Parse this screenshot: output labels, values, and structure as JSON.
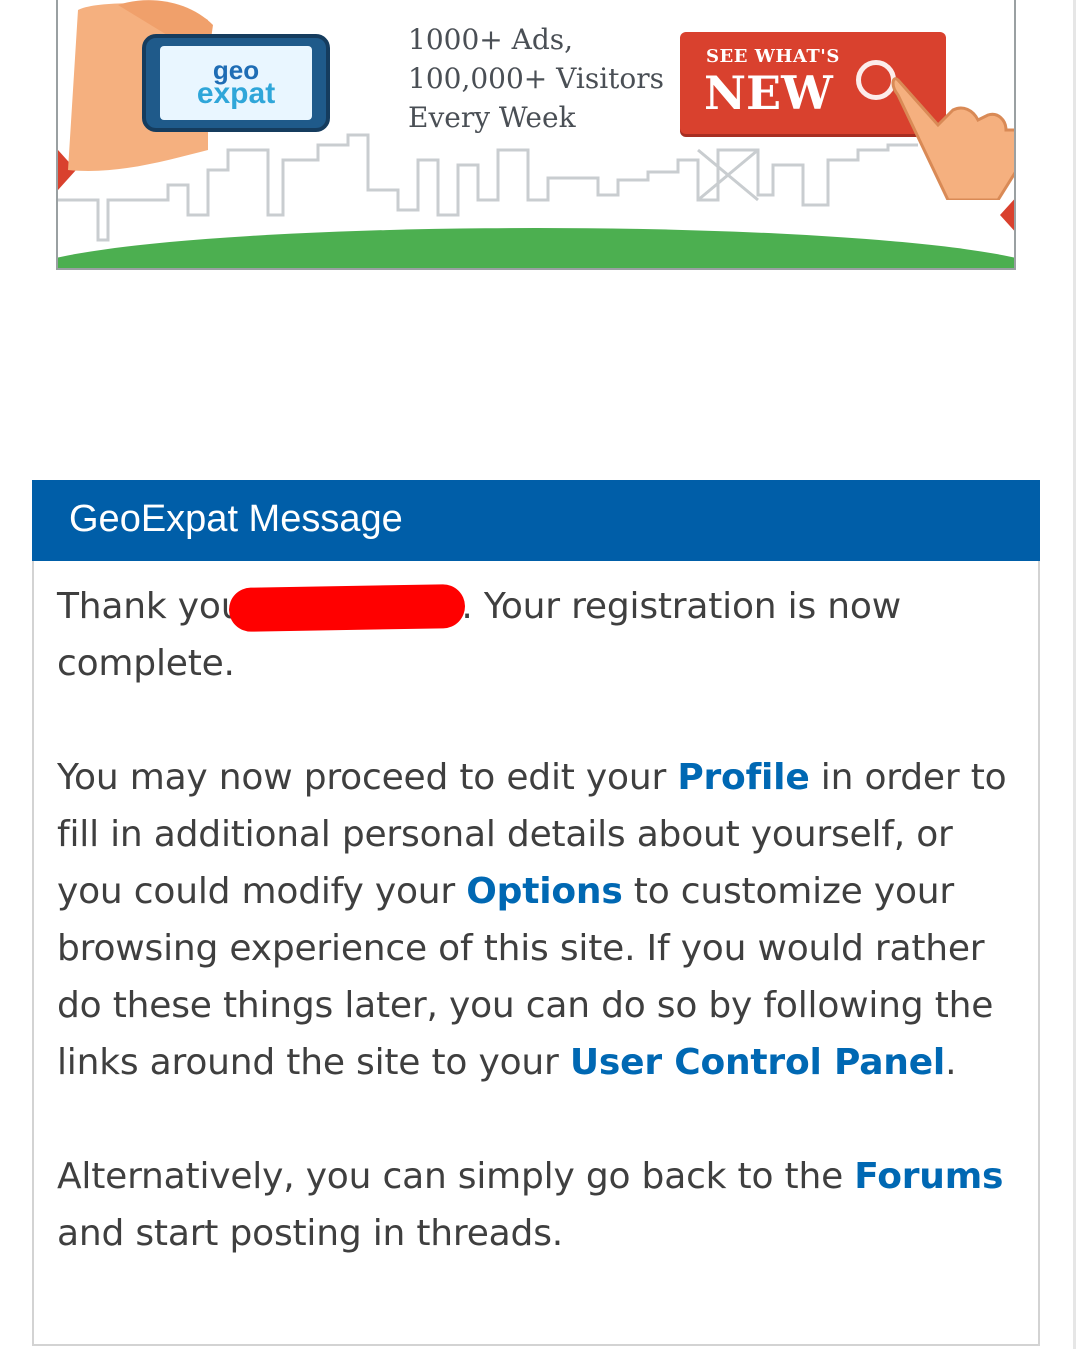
{
  "banner": {
    "logo_top": "geo",
    "logo_bottom": "expat",
    "line1": "1000+ Ads,",
    "line2": "100,000+ Visitors",
    "line3": "Every Week",
    "cta_small": "SEE WHAT'S",
    "cta_big": "NEW"
  },
  "message": {
    "title": "GeoExpat Message",
    "thank_prefix": "Thank you",
    "thank_suffix": ". Your registration is now complete.",
    "p2_a": "You may now proceed to edit your ",
    "profile_link": "Profile",
    "p2_b": " in order to fill in additional personal details about yourself, or you could modify your ",
    "options_link": "Options",
    "p2_c": " to customize your browsing experience of this site. If you would rather do these things later, you can do so by following the links around the site to your ",
    "ucp_link": "User Control Panel",
    "p2_d": ".",
    "p3_a": "Alternatively, you can simply go back to the ",
    "forums_link": "Forums",
    "p3_b": " and start posting in threads."
  },
  "colors": {
    "header_bg": "#005ea8",
    "link": "#0068b3",
    "cta_bg": "#d9412e",
    "grass": "#4caf50",
    "redaction": "#ff0000"
  }
}
